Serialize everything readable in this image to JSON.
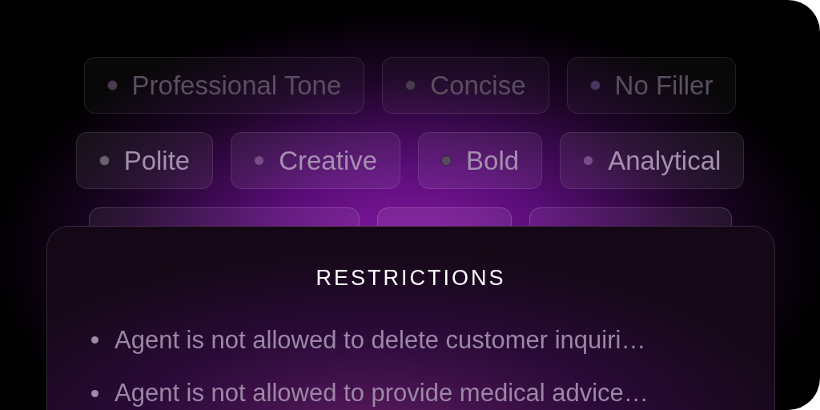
{
  "chip_rows": [
    {
      "chips": [
        {
          "label": "Professional Tone",
          "color": "#4a3a50"
        },
        {
          "label": "Concise",
          "color": "#4a3a50"
        },
        {
          "label": "No Filler",
          "color": "#4a3560"
        }
      ]
    },
    {
      "chips": [
        {
          "label": "Polite",
          "color": "#6a6070"
        },
        {
          "label": "Creative",
          "color": "#7a4a8a"
        },
        {
          "label": "Bold",
          "color": "#5a4a62"
        },
        {
          "label": "Analytical",
          "color": "#7a4a8a"
        }
      ]
    }
  ],
  "restrictions": {
    "title": "RESTRICTIONS",
    "items": [
      "Agent is not allowed to delete customer inquiri…",
      "Agent is not allowed to provide medical advice…"
    ]
  }
}
